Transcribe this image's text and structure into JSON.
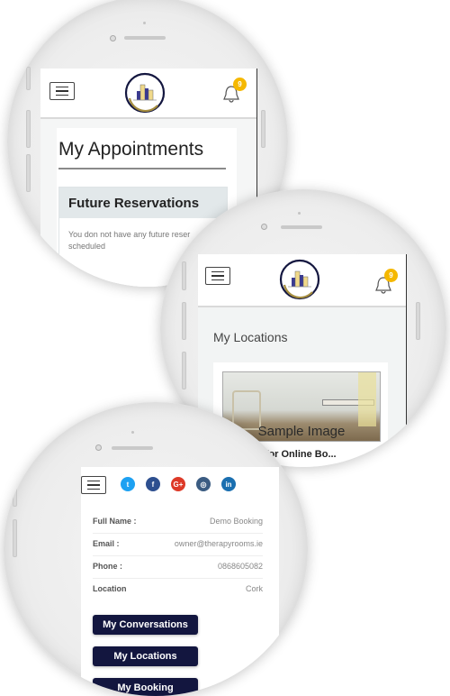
{
  "screen1": {
    "notification_count": "9",
    "page_title": "My Appointments",
    "card_title": "Future Reservations",
    "card_text_line1": "You don not have any future reser",
    "card_text_line2": "scheduled"
  },
  "screen2": {
    "notification_count": "9",
    "page_title": "My Locations",
    "image_caption": "Sample Image",
    "location_title": "g for Online Bo..."
  },
  "screen3": {
    "social": [
      {
        "name": "twitter",
        "glyph": "t",
        "color": "#1da1f2"
      },
      {
        "name": "facebook",
        "glyph": "f",
        "color": "#2d4f8f"
      },
      {
        "name": "google-plus",
        "glyph": "G+",
        "color": "#dd3a28"
      },
      {
        "name": "instagram",
        "glyph": "◎",
        "color": "#3b5c82"
      },
      {
        "name": "linkedin",
        "glyph": "in",
        "color": "#1a6fb0"
      }
    ],
    "profile": [
      {
        "label": "Full Name :",
        "value": "Demo Booking"
      },
      {
        "label": "Email :",
        "value": "owner@therapyrooms.ie"
      },
      {
        "label": "Phone :",
        "value": "0868605082"
      },
      {
        "label": "Location",
        "value": "Cork"
      }
    ],
    "buttons": [
      "My Conversations",
      "My Locations",
      "My Booking"
    ]
  },
  "colors": {
    "navy": "#13163f",
    "badge": "#f5b800",
    "card_header": "#e2e8ea"
  }
}
